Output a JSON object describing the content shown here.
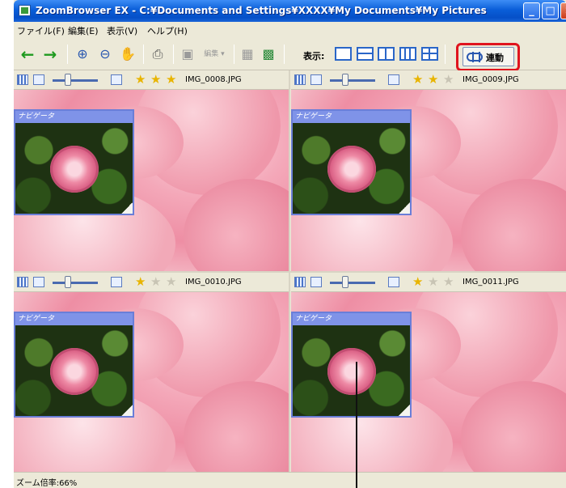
{
  "window": {
    "title": "ZoomBrowser EX - C:¥Documents and Settings¥XXXX¥My Documents¥My Pictures"
  },
  "menu": [
    "ファイル(F)",
    "編集(E)",
    "表示(V)",
    "ヘルプ(H)"
  ],
  "toolbar": {
    "display_label": "表示:",
    "sync_label": "連動",
    "edit_label": "編集"
  },
  "panes": [
    {
      "file": "IMG_0008.JPG",
      "stars": 3,
      "navigator_title": "ナビゲータ"
    },
    {
      "file": "IMG_0009.JPG",
      "stars": 2,
      "navigator_title": "ナビゲータ"
    },
    {
      "file": "IMG_0010.JPG",
      "stars": 1,
      "navigator_title": "ナビゲータ"
    },
    {
      "file": "IMG_0011.JPG",
      "stars": 1,
      "navigator_title": "ナビゲータ"
    }
  ],
  "status": {
    "zoom": "ズーム倍率:66%"
  },
  "colors": {
    "title_bar": "#0a5ed8",
    "highlight": "#e0141e",
    "navigator_border": "#6a7ed8"
  }
}
